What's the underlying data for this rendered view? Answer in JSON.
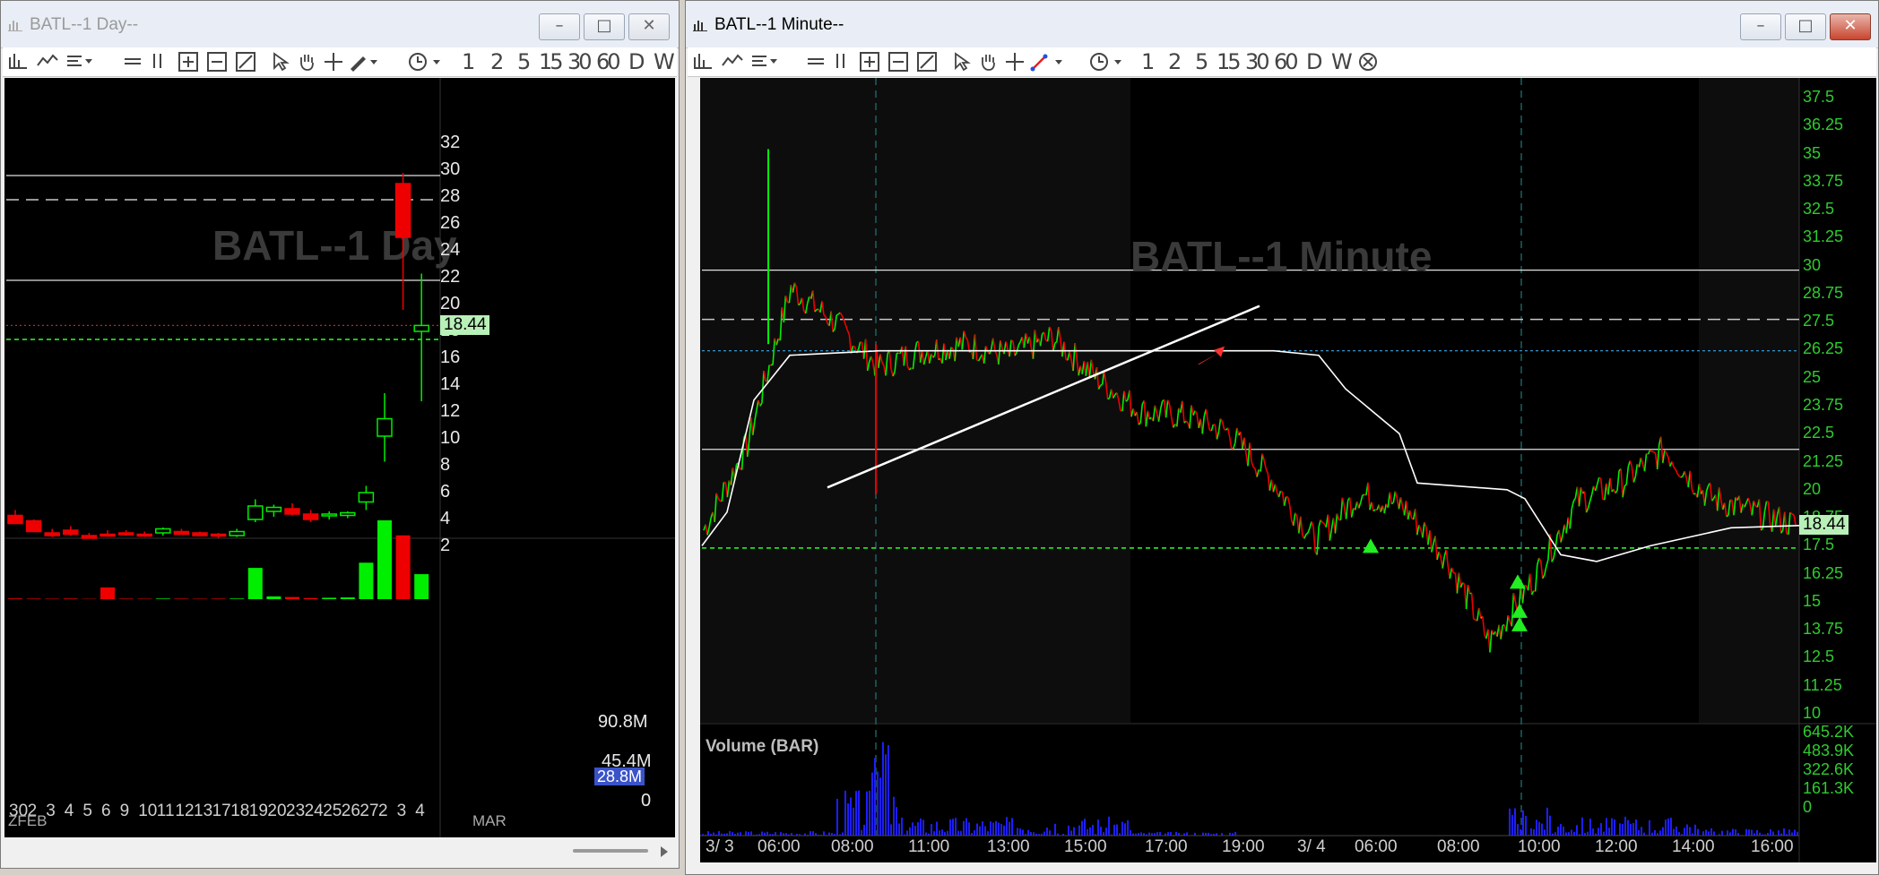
{
  "day_window": {
    "title": "BATL--1 Day--",
    "watermark": "BATL--1 Day",
    "toolbar": {
      "periods": [
        "1",
        "2",
        "5",
        "15",
        "30",
        "60",
        "D",
        "W"
      ]
    },
    "price_axis": [
      "32",
      "30",
      "28",
      "26",
      "24",
      "22",
      "20",
      "18",
      "16",
      "14",
      "12",
      "10",
      "8",
      "6",
      "4",
      "2"
    ],
    "price_tag": "18.44",
    "volume_axis": {
      "top": "90.8M",
      "mid": "45.4M",
      "zero": "0",
      "tag": "28.8M"
    },
    "x_labels": [
      "30",
      "2",
      "3",
      "4",
      "5",
      "6",
      "9",
      "10",
      "11",
      "12",
      "13",
      "17",
      "18",
      "19",
      "20",
      "23",
      "24",
      "25",
      "26",
      "27",
      "2",
      "3",
      "4"
    ],
    "x_sublabels": {
      "left": "ZFEB",
      "month": "MAR"
    }
  },
  "minute_window": {
    "title": "BATL--1 Minute--",
    "watermark": "BATL--1 Minute",
    "toolbar": {
      "periods": [
        "1",
        "2",
        "5",
        "15",
        "30",
        "60",
        "D",
        "W"
      ]
    },
    "price_axis": [
      "37.5",
      "36.25",
      "35",
      "33.75",
      "32.5",
      "31.25",
      "30",
      "28.75",
      "27.5",
      "26.25",
      "25",
      "23.75",
      "22.5",
      "21.25",
      "20",
      "18.75",
      "17.5",
      "16.25",
      "15",
      "13.75",
      "12.5",
      "11.25",
      "10"
    ],
    "price_tag": "18.44",
    "volume_title": "Volume (BAR)",
    "volume_axis": [
      "645.2K",
      "483.9K",
      "322.6K",
      "161.3K",
      "0"
    ],
    "x_labels": [
      "3/ 3",
      "06:00",
      "08:00",
      "11:00",
      "13:00",
      "15:00",
      "17:00",
      "19:00",
      "3/ 4",
      "06:00",
      "08:00",
      "10:00",
      "12:00",
      "14:00",
      "16:00"
    ]
  },
  "colors": {
    "up": "#00ee00",
    "down": "#ee0000",
    "bg": "#000000",
    "vwap": "#ffffff",
    "volume": "#1e1eff",
    "accent_green": "#2ecc2e"
  },
  "chart_data": [
    {
      "type": "candlestick",
      "title": "BATL--1 Day",
      "categories": [
        "30",
        "2",
        "3",
        "4",
        "5",
        "6",
        "9",
        "10",
        "11",
        "12",
        "13",
        "17",
        "18",
        "19",
        "20",
        "23",
        "24",
        "25",
        "26",
        "27",
        "2",
        "3",
        "4"
      ],
      "open": [
        4.3,
        3.9,
        3.0,
        3.2,
        2.8,
        2.9,
        3.0,
        2.9,
        3.0,
        3.1,
        3.0,
        2.9,
        2.8,
        4.0,
        4.6,
        4.8,
        4.4,
        4.3,
        4.3,
        5.3,
        10.2,
        29.0,
        18.0
      ],
      "high": [
        4.7,
        4.0,
        3.3,
        3.5,
        3.0,
        3.2,
        3.2,
        3.1,
        3.4,
        3.3,
        3.1,
        3.0,
        3.3,
        5.5,
        5.1,
        5.2,
        4.7,
        4.6,
        4.6,
        6.5,
        13.4,
        29.8,
        22.3
      ],
      "low": [
        3.8,
        3.2,
        2.7,
        2.8,
        2.6,
        2.7,
        2.8,
        2.7,
        2.8,
        2.9,
        2.8,
        2.6,
        2.7,
        3.8,
        4.2,
        4.3,
        3.8,
        4.0,
        4.1,
        4.7,
        8.3,
        19.6,
        12.8
      ],
      "close": [
        3.7,
        3.1,
        2.8,
        2.9,
        2.6,
        2.8,
        2.9,
        2.8,
        3.3,
        2.9,
        2.8,
        2.8,
        3.1,
        5.0,
        4.9,
        4.4,
        4.0,
        4.4,
        4.5,
        6.0,
        11.5,
        25.0,
        18.44
      ],
      "volume_m": [
        0.8,
        0.6,
        0.5,
        0.7,
        0.4,
        13.5,
        0.6,
        0.5,
        0.7,
        0.6,
        0.5,
        0.6,
        0.7,
        36.0,
        3.2,
        2.5,
        1.2,
        1.6,
        2.0,
        42.0,
        90.8,
        73.5,
        28.8
      ],
      "levels": [
        29.6,
        27.8,
        21.8,
        18.44,
        17.4
      ],
      "ylim": [
        0,
        33
      ],
      "xlabel": "",
      "ylabel": ""
    },
    {
      "type": "line",
      "title": "BATL--1 Minute",
      "x": [
        "3/ 3",
        "06:00",
        "08:00",
        "11:00",
        "13:00",
        "15:00",
        "17:00",
        "19:00",
        "3/ 4",
        "06:00",
        "08:00",
        "10:00",
        "12:00",
        "14:00",
        "16:00"
      ],
      "series": [
        {
          "name": "",
          "values": [
            18.2,
            22.0,
            29.0,
            27.5,
            25.5,
            26.2,
            26.5,
            26.0,
            26.8,
            25.0,
            23.5,
            23.3,
            22.6,
            20.5,
            17.7,
            19.8,
            19.3,
            17.0,
            13.2,
            16.0,
            19.5,
            20.3,
            21.8,
            19.7,
            19.0,
            18.44
          ]
        }
      ],
      "levels": [
        29.8,
        27.6,
        26.2,
        21.8,
        17.4
      ],
      "ylim": [
        10,
        38
      ],
      "volume_k_max": 645.2,
      "xlabel": "",
      "ylabel": ""
    }
  ]
}
